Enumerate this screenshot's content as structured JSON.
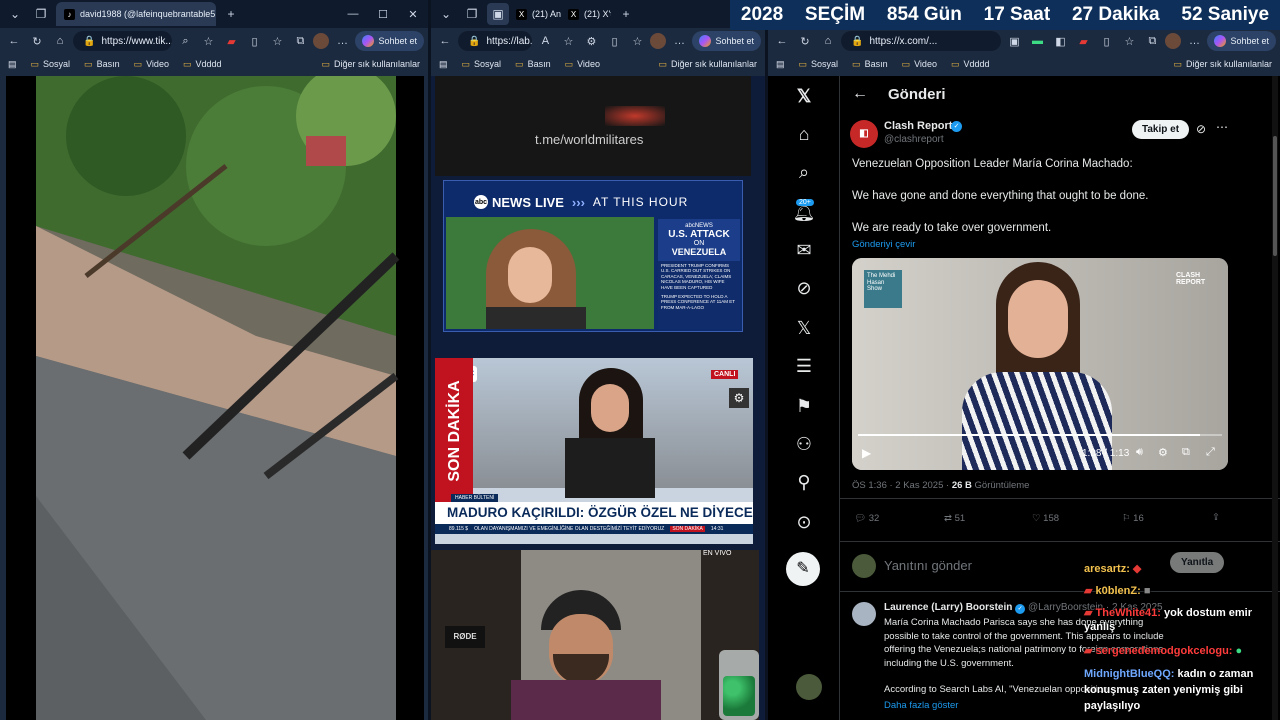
{
  "countdown": {
    "year": "2028",
    "label": "SEÇİM",
    "days": "854 Gün",
    "hours": "17 Saat",
    "minutes": "27 Dakika",
    "seconds": "52 Saniye"
  },
  "bookmarks": {
    "items": [
      "Sosyal",
      "Basın",
      "Video",
      "Vdddd"
    ],
    "other": "Diğer sık kullanılanlar"
  },
  "copilot_label": "Sohbet et",
  "left_browser": {
    "tab_title": "david1988 (@lafeinquebrantable5",
    "url": "https://www.tik..."
  },
  "mid_browser": {
    "tab1": "(21) An",
    "tab2": "(21) X'te",
    "url": "https://lab...",
    "watermark": "t.me/worldmilitares",
    "abc": {
      "brand": "NEWS",
      "live": "LIVE",
      "banner": "AT THIS HOUR",
      "side_brand": "abcNEWS",
      "headline1": "U.S. ATTACK",
      "headline2": "ON",
      "headline3": "VENEZUELA",
      "bullet1": "PRESIDENT TRUMP CONFIRMS U.S. CARRIED OUT STRIKES ON CARACAS, VENEZUELA; CLAIMS NICOLAS MADURO, HIS WIFE HAVE BEEN CAPTURED",
      "bullet2": "TRUMP EXPECTED TO HOLD A PRESS CONFERENCE AT 11AM ET FROM MAR-A-LAGO"
    },
    "szc": {
      "logo": "SZC",
      "live": "CANLI",
      "vertical": "SON DAKİKA",
      "bulletin": "HABER BÜLTENİ",
      "headline": "MADURO KAÇIRILDI: ÖZGÜR ÖZEL NE DİYECEK?",
      "ticker": "89.115 $",
      "ticker_text": "OLAN DAYANIŞMAMIZI VE EMEGİNLİĞİNE OLAN DESTEĞİMİZİ TEYİT EDİYORUZ",
      "ticker_tag": "SON DAKİKA",
      "time": "14:31",
      "mic": "SZC"
    },
    "stream": {
      "en_vivo": "EN VIVO",
      "mic_brand": "RØDE"
    }
  },
  "right_browser": {
    "url": "https://x.com/...",
    "notif_badge": "20+",
    "header": "Gönderi",
    "post": {
      "author": "Clash Report",
      "handle": "@clashreport",
      "follow": "Takip et",
      "line1": "Venezuelan Opposition Leader María Corina Machado:",
      "line2": "We have gone and done everything that ought to be done.",
      "line3": "We are ready to take over government.",
      "translate": "Gönderiyi çevir",
      "video_brand": "CLASH REPORT",
      "video_logo": "The Mehdi Hasan Show",
      "video_time": "1:08 / 1:13",
      "video_progress": 0.94,
      "meta_time": "ÖS 1:36 · 2 Kas 2025 ·",
      "views": "26 B",
      "views_label": "Görüntüleme",
      "replies": "32",
      "reposts": "51",
      "likes": "158",
      "bookmarks": "16"
    },
    "reply_placeholder": "Yanıtını gönder",
    "reply_button": "Yanıtla",
    "reply": {
      "author": "Laurence (Larry) Boorstein",
      "handle": "@LarryBoorstein",
      "date": "· 2 Kas 2025",
      "text": "María Corina Machado Parisca says she has done everything possible to take control of the government. This appears to include offering the Venezuela;s national patrimony to foreign corporations including the U.S. government.",
      "text2": "According to Search Labs AI, \"Venezuelan opposition",
      "more": "Daha fazla göster"
    }
  },
  "chat": [
    {
      "user": "aresartz:",
      "msg": "",
      "color": "#f2c14e"
    },
    {
      "user": "k0blenZ:",
      "msg": "",
      "color": "#f2c14e"
    },
    {
      "user": "TheWhite41:",
      "msg": "yok dostum emir yanlış",
      "color": "#ff3b3b"
    },
    {
      "user": "sergenedemodgokcelogu:",
      "msg": "",
      "color": "#ff3b3b"
    },
    {
      "user": "MidnightBlueQQ:",
      "msg": "kadın o zaman konuşmuş zaten yeniymiş gibi paylaşılıyo",
      "color": "#6fa8ff"
    }
  ]
}
